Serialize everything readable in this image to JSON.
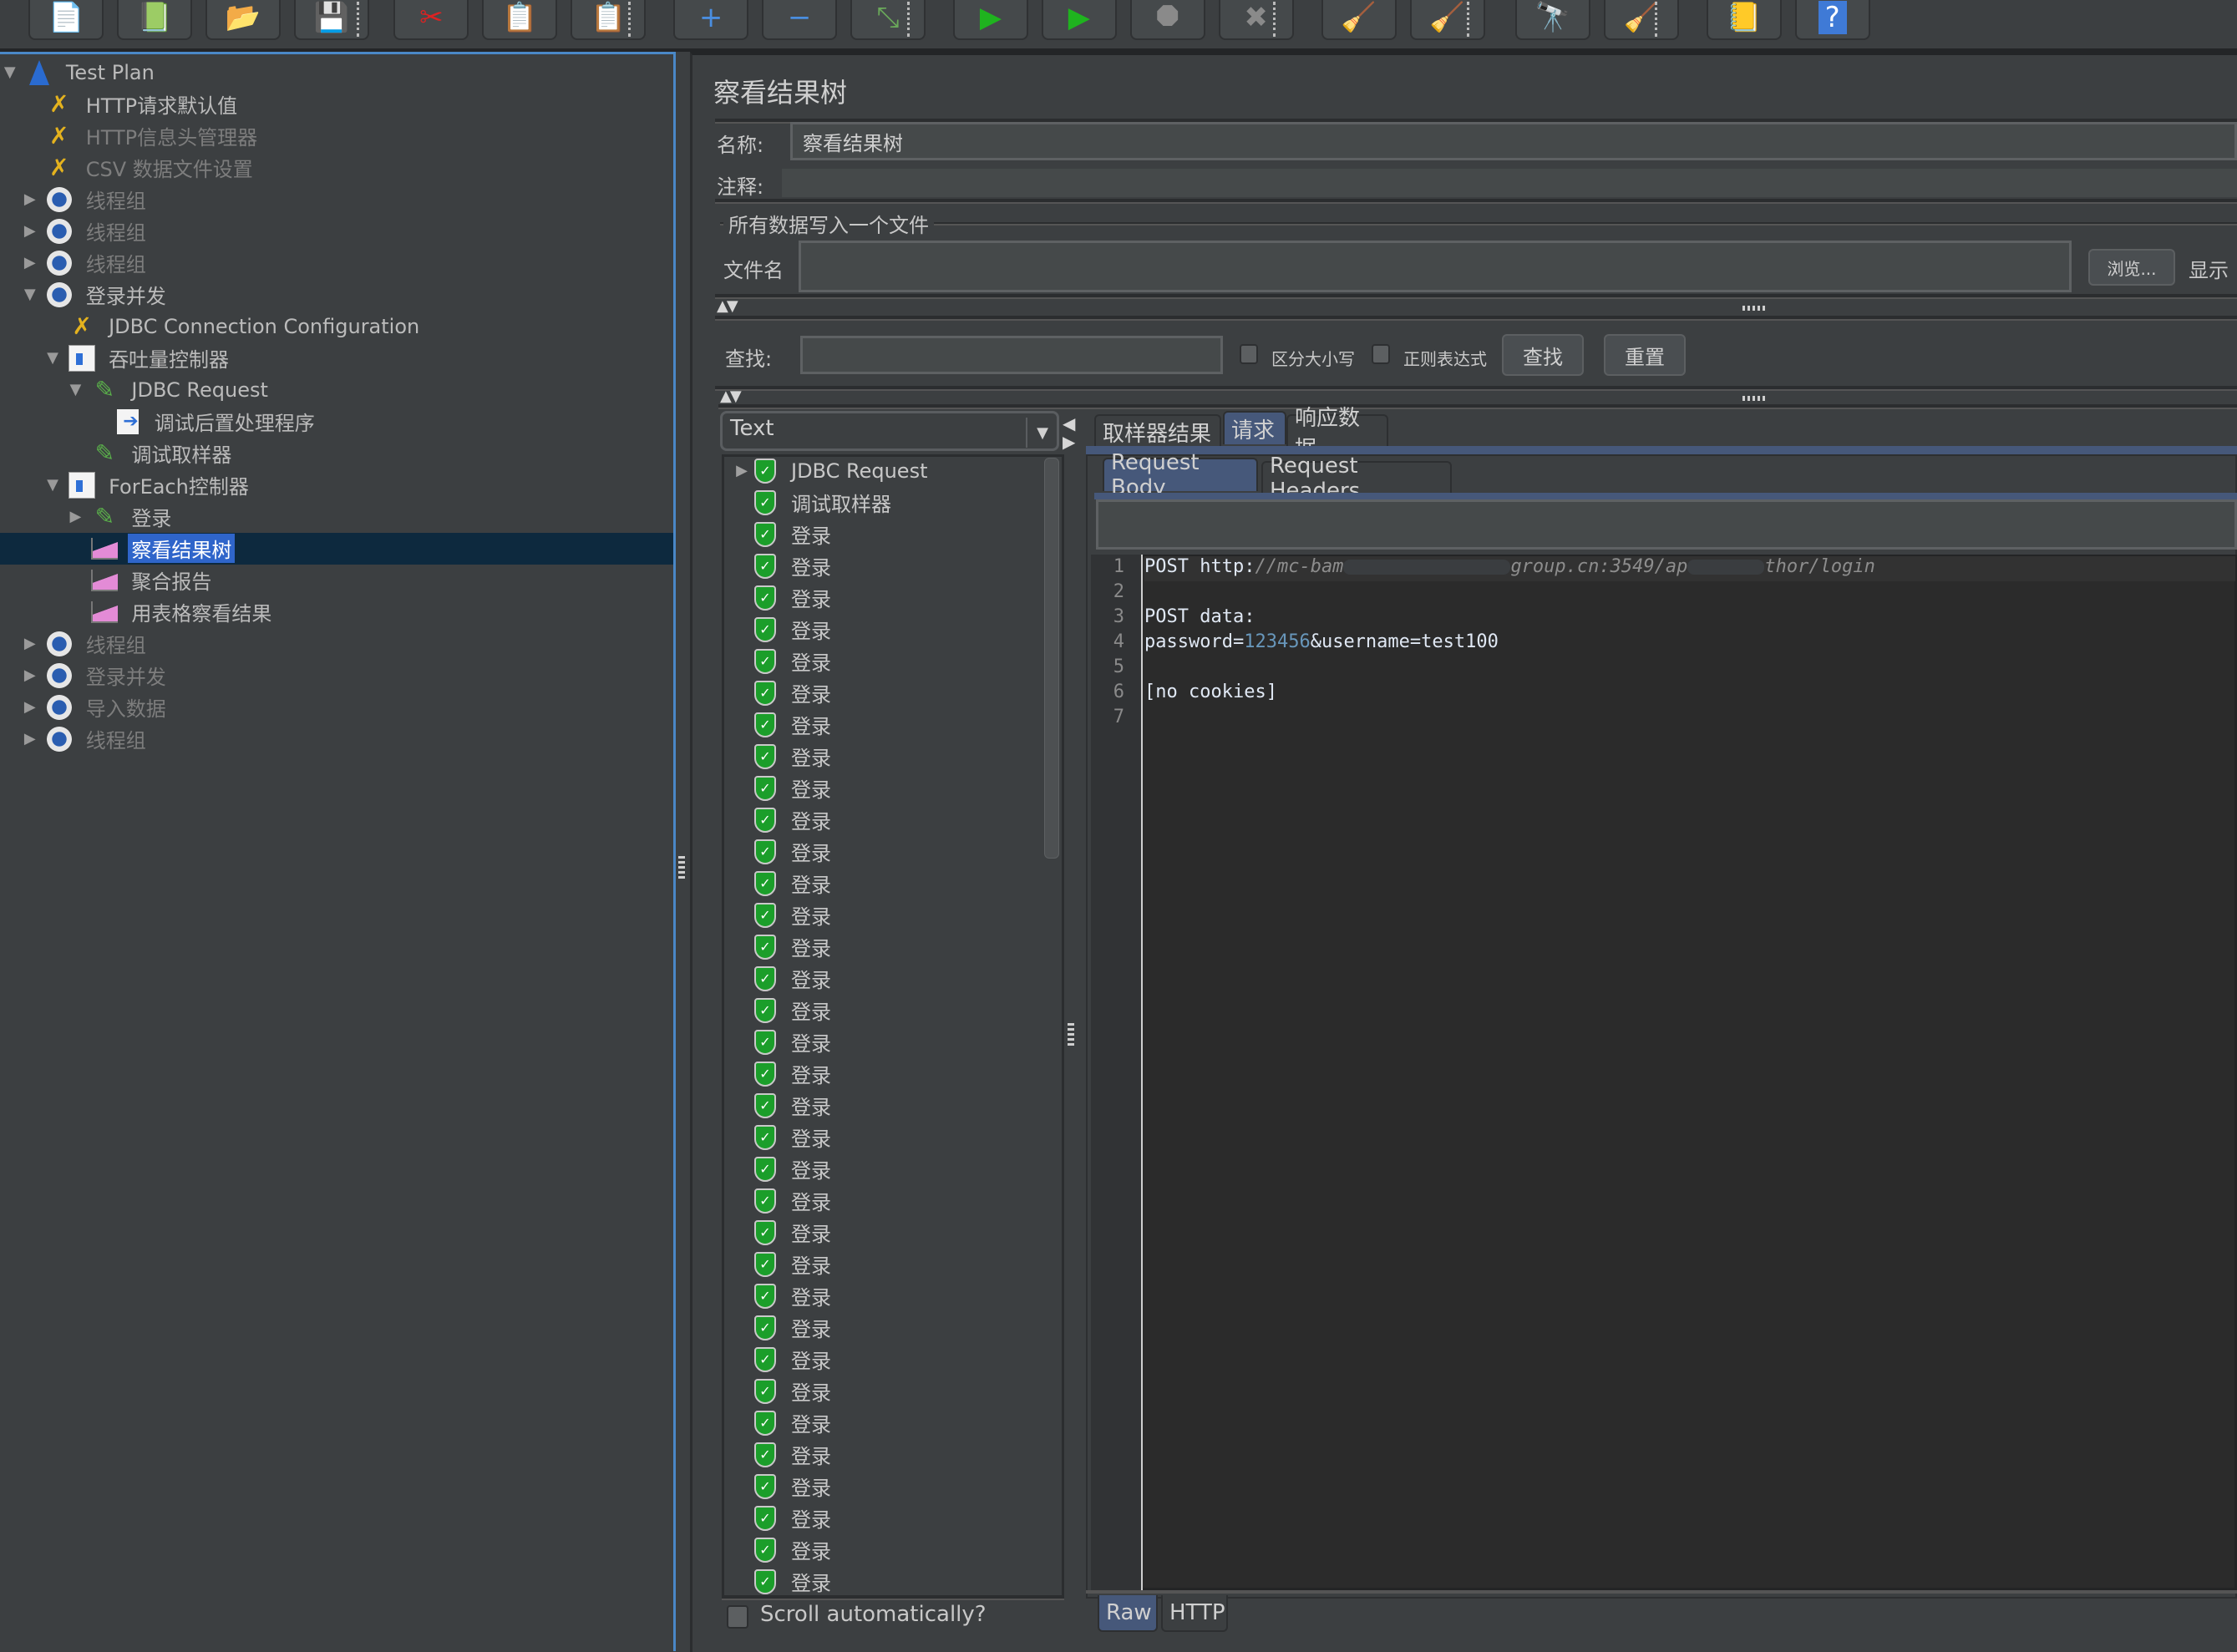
{
  "toolbar": {
    "buttons": [
      {
        "name": "new-icon",
        "glyph": "📄"
      },
      {
        "name": "templates-icon",
        "glyph": "📗"
      },
      {
        "name": "open-icon",
        "glyph": "📂"
      },
      {
        "name": "save-icon",
        "glyph": "💾"
      },
      {
        "name": "cut-icon",
        "glyph": "✂"
      },
      {
        "name": "copy-icon",
        "glyph": "📋"
      },
      {
        "name": "paste-icon",
        "glyph": "📋"
      },
      {
        "name": "expand-icon",
        "glyph": "+"
      },
      {
        "name": "collapse-icon",
        "glyph": "−"
      },
      {
        "name": "toggle-icon",
        "glyph": "⤡"
      },
      {
        "name": "start-icon",
        "glyph": "▶"
      },
      {
        "name": "start-no-pauses-icon",
        "glyph": "▶"
      },
      {
        "name": "stop-icon",
        "glyph": "⯃"
      },
      {
        "name": "shutdown-icon",
        "glyph": "✖"
      },
      {
        "name": "clear-icon",
        "glyph": "🧹"
      },
      {
        "name": "clear-all-icon",
        "glyph": "🧹"
      },
      {
        "name": "search-icon",
        "glyph": "🔭"
      },
      {
        "name": "reset-search-icon",
        "glyph": "🧹"
      },
      {
        "name": "function-helper-icon",
        "glyph": "📒"
      },
      {
        "name": "help-icon",
        "glyph": "?"
      }
    ]
  },
  "tree": {
    "items": [
      {
        "label": "Test Plan",
        "icon": "flask",
        "toggle": "▼",
        "level": 0,
        "disabled": false,
        "selected": false
      },
      {
        "label": "HTTP请求默认值",
        "icon": "wrench",
        "toggle": "",
        "level": 1,
        "disabled": false,
        "selected": false
      },
      {
        "label": "HTTP信息头管理器",
        "icon": "wrench",
        "toggle": "",
        "level": 1,
        "disabled": true,
        "selected": false
      },
      {
        "label": "CSV 数据文件设置",
        "icon": "wrench",
        "toggle": "",
        "level": 1,
        "disabled": true,
        "selected": false
      },
      {
        "label": "线程组",
        "icon": "gear",
        "toggle": "▶",
        "level": 1,
        "disabled": true,
        "selected": false
      },
      {
        "label": "线程组",
        "icon": "gear",
        "toggle": "▶",
        "level": 1,
        "disabled": true,
        "selected": false
      },
      {
        "label": "线程组",
        "icon": "gear",
        "toggle": "▶",
        "level": 1,
        "disabled": true,
        "selected": false
      },
      {
        "label": "登录并发",
        "icon": "gear",
        "toggle": "▼",
        "level": 1,
        "disabled": false,
        "selected": false
      },
      {
        "label": "JDBC Connection Configuration",
        "icon": "wrench",
        "toggle": "",
        "level": 2,
        "disabled": false,
        "selected": false
      },
      {
        "label": "吞吐量控制器",
        "icon": "ctrl",
        "toggle": "▼",
        "level": 2,
        "disabled": false,
        "selected": false
      },
      {
        "label": "JDBC Request",
        "icon": "pipette",
        "toggle": "▼",
        "level": 3,
        "disabled": false,
        "selected": false
      },
      {
        "label": "调试后置处理程序",
        "icon": "post",
        "toggle": "",
        "level": 4,
        "disabled": false,
        "selected": false
      },
      {
        "label": "调试取样器",
        "icon": "pipette",
        "toggle": "",
        "level": 3,
        "disabled": false,
        "selected": false
      },
      {
        "label": "ForEach控制器",
        "icon": "ctrl",
        "toggle": "▼",
        "level": 2,
        "disabled": false,
        "selected": false
      },
      {
        "label": "登录",
        "icon": "pipette",
        "toggle": "▶",
        "level": 3,
        "disabled": false,
        "selected": false
      },
      {
        "label": "察看结果树",
        "icon": "listener",
        "toggle": "",
        "level": 3,
        "disabled": false,
        "selected": true
      },
      {
        "label": "聚合报告",
        "icon": "listener",
        "toggle": "",
        "level": 3,
        "disabled": false,
        "selected": false
      },
      {
        "label": "用表格察看结果",
        "icon": "listener",
        "toggle": "",
        "level": 3,
        "disabled": false,
        "selected": false
      },
      {
        "label": "线程组",
        "icon": "gear",
        "toggle": "▶",
        "level": 1,
        "disabled": true,
        "selected": false
      },
      {
        "label": "登录并发",
        "icon": "gear",
        "toggle": "▶",
        "level": 1,
        "disabled": true,
        "selected": false
      },
      {
        "label": "导入数据",
        "icon": "gear",
        "toggle": "▶",
        "level": 1,
        "disabled": true,
        "selected": false
      },
      {
        "label": "线程组",
        "icon": "gear",
        "toggle": "▶",
        "level": 1,
        "disabled": true,
        "selected": false
      }
    ]
  },
  "panel": {
    "title": "察看结果树",
    "name_label": "名称:",
    "name_value": "察看结果树",
    "comment_label": "注释:",
    "comment_value": "",
    "file_group_label": "所有数据写入一个文件",
    "filename_label": "文件名",
    "filename_value": "",
    "browse_label": "浏览...",
    "show_label": "显示"
  },
  "search": {
    "label": "查找:",
    "value": "",
    "case_sensitive_label": "区分大小写",
    "case_sensitive_checked": false,
    "regex_label": "正则表达式",
    "regex_checked": false,
    "find_label": "查找",
    "reset_label": "重置"
  },
  "results": {
    "renderer_selected": "Text",
    "items": [
      {
        "label": "JDBC Request",
        "status": "success",
        "expandable": true
      },
      {
        "label": "调试取样器",
        "status": "success",
        "expandable": false
      },
      {
        "label": "登录",
        "status": "success"
      },
      {
        "label": "登录",
        "status": "success"
      },
      {
        "label": "登录",
        "status": "success"
      },
      {
        "label": "登录",
        "status": "success"
      },
      {
        "label": "登录",
        "status": "success"
      },
      {
        "label": "登录",
        "status": "success"
      },
      {
        "label": "登录",
        "status": "success"
      },
      {
        "label": "登录",
        "status": "success"
      },
      {
        "label": "登录",
        "status": "success"
      },
      {
        "label": "登录",
        "status": "success"
      },
      {
        "label": "登录",
        "status": "success"
      },
      {
        "label": "登录",
        "status": "success"
      },
      {
        "label": "登录",
        "status": "success"
      },
      {
        "label": "登录",
        "status": "success"
      },
      {
        "label": "登录",
        "status": "success"
      },
      {
        "label": "登录",
        "status": "success"
      },
      {
        "label": "登录",
        "status": "success"
      },
      {
        "label": "登录",
        "status": "success"
      },
      {
        "label": "登录",
        "status": "success"
      },
      {
        "label": "登录",
        "status": "success"
      },
      {
        "label": "登录",
        "status": "success"
      },
      {
        "label": "登录",
        "status": "success"
      },
      {
        "label": "登录",
        "status": "success"
      },
      {
        "label": "登录",
        "status": "success"
      },
      {
        "label": "登录",
        "status": "success"
      },
      {
        "label": "登录",
        "status": "success"
      },
      {
        "label": "登录",
        "status": "success"
      },
      {
        "label": "登录",
        "status": "success"
      },
      {
        "label": "登录",
        "status": "success"
      },
      {
        "label": "登录",
        "status": "success"
      },
      {
        "label": "登录",
        "status": "success"
      },
      {
        "label": "登录",
        "status": "success"
      },
      {
        "label": "登录",
        "status": "success"
      },
      {
        "label": "登录",
        "status": "success"
      }
    ],
    "scroll_auto_label": "Scroll automatically?",
    "scroll_auto_checked": false
  },
  "detail": {
    "tabs": [
      {
        "label": "取样器结果",
        "active": false
      },
      {
        "label": "请求",
        "active": true
      },
      {
        "label": "响应数据",
        "active": false
      }
    ],
    "subtabs": [
      {
        "label": "Request Body",
        "active": true
      },
      {
        "label": "Request Headers",
        "active": false
      }
    ],
    "editor": {
      "line_numbers": [
        "1",
        "2",
        "3",
        "4",
        "5",
        "6",
        "7"
      ],
      "line1_method": "POST ",
      "line1_scheme": "http:",
      "line1_url_a": "//mc-bam",
      "line1_url_b": "group.cn:3",
      "line1_url_c": "549/ap",
      "line1_url_d": "thor/login",
      "line3": "POST data:",
      "line4_key": "password=",
      "line4_value": "123456",
      "line4_rest": "&username=test100",
      "line6": "[no cookies]"
    },
    "bottom_tabs": [
      {
        "label": "Raw",
        "active": true
      },
      {
        "label": "HTTP",
        "active": false
      }
    ]
  }
}
